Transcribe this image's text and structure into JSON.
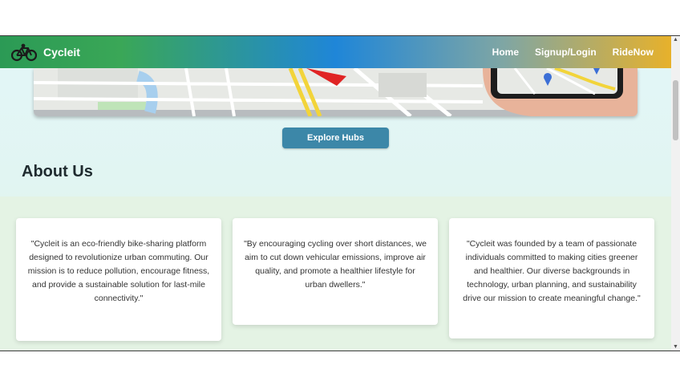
{
  "navbar": {
    "brand_name": "Cycleit",
    "brand_icon": "bicycle-icon",
    "links": [
      "Home",
      "Signup/Login",
      "RideNow"
    ]
  },
  "hero": {
    "explore_button": "Explore Hubs"
  },
  "about": {
    "title": "About Us",
    "cards": [
      "\"Cycleit is an eco-friendly bike-sharing platform designed to revolutionize urban commuting. Our mission is to reduce pollution, encourage fitness, and provide a sustainable solution for last-mile connectivity.\"",
      "\"By encouraging cycling over short distances, we aim to cut down vehicular emissions, improve air quality, and promote a healthier lifestyle for urban dwellers.\"",
      "\"Cycleit was founded by a team of passionate individuals committed to making cities greener and healthier. Our diverse backgrounds in technology, urban planning, and sustainability drive our mission to create meaningful change.\""
    ]
  },
  "colors": {
    "navbar_gradient": [
      "#2b9a55",
      "#1f86d8",
      "#e7b12b"
    ],
    "button": "#3c87a8",
    "about_bg": "#e4f3e4"
  }
}
